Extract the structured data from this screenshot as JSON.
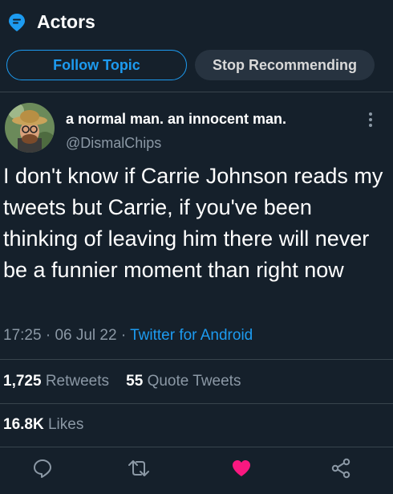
{
  "topic": {
    "icon": "topic-pin-icon",
    "title": "Actors",
    "follow_label": "Follow Topic",
    "stop_label": "Stop Recommending"
  },
  "author": {
    "display_name": "a normal man. an innocent man.",
    "handle": "@DismalChips",
    "avatar": "avatar-image"
  },
  "tweet": {
    "text": "I don't know if Carrie Johnson reads my tweets but Carrie, if you've been thinking of leaving him there will never be a funnier moment than right now",
    "time": "17:25",
    "date": "06 Jul 22",
    "client": "Twitter for Android",
    "separator": "·"
  },
  "stats": {
    "retweets_count": "1,725",
    "retweets_label": "Retweets",
    "quotes_count": "55",
    "quotes_label": "Quote Tweets",
    "likes_count": "16.8K",
    "likes_label": "Likes"
  },
  "actions": {
    "reply_icon": "reply-icon",
    "retweet_icon": "retweet-icon",
    "like_icon": "heart-icon",
    "share_icon": "share-icon"
  },
  "colors": {
    "background": "#15202b",
    "accent": "#1d9bf0",
    "secondary_text": "#8b98a5",
    "like": "#f91880",
    "divider": "#38444d"
  }
}
